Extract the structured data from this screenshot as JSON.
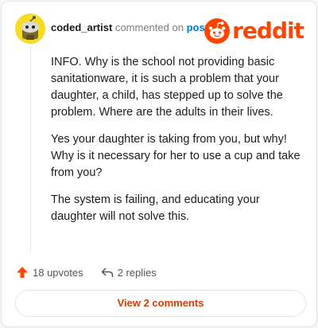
{
  "header": {
    "username": "coded_artist",
    "commented_text": "commented on",
    "post_link": "post",
    "logo_text": "reddit"
  },
  "comment": {
    "paragraphs": [
      "INFO. Why is the school not providing basic sanitationware, it is such a problem that your daughter, a child, has stepped up to solve the problem. Where are the adults in their lives.",
      "Yes your daughter is taking from you, but why! Why is it necessary for her to use a cup and take from you?",
      "The system is failing, and educating your daughter will not solve this."
    ]
  },
  "actions": {
    "upvotes": "18 upvotes",
    "replies": "2 replies"
  },
  "view_comments_label": "View 2 comments",
  "colors": {
    "accent": "#ff4500",
    "link": "#0079d3",
    "view_button_text": "#d93a00",
    "avatar_bg": "#f5dc21"
  },
  "icons": {
    "avatar": "snoo-avatar-icon",
    "logo": "reddit-logo-icon",
    "upvote": "upvote-arrow-icon",
    "reply": "reply-arrow-icon"
  }
}
